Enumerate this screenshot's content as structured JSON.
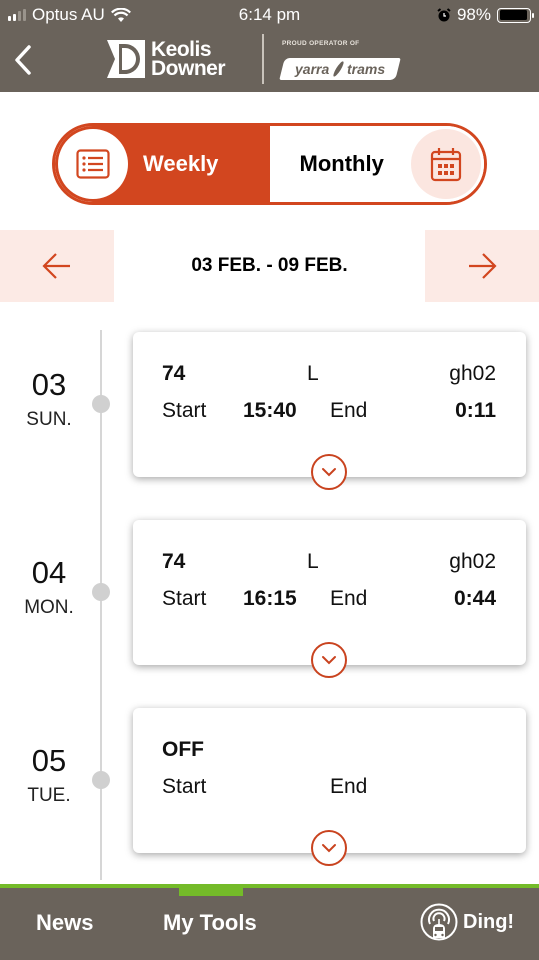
{
  "status_bar": {
    "carrier": "Optus AU",
    "time": "6:14 pm",
    "battery": "98%",
    "battery_level": 0.98,
    "icons": [
      "signal-icon",
      "wifi-icon",
      "alarm-icon",
      "battery-icon"
    ]
  },
  "header": {
    "back_icon": "chevron-left-icon",
    "brand_line1": "Keolis",
    "brand_line2": "Downer",
    "tagline": "PROUD OPERATOR OF",
    "partner_left": "yarra",
    "partner_right": "trams"
  },
  "toggle": {
    "weekly_label": "Weekly",
    "monthly_label": "Monthly",
    "selected": "weekly",
    "weekly_icon": "list-icon",
    "monthly_icon": "calendar-icon"
  },
  "week_nav": {
    "range": "03 FEB. - 09 FEB.",
    "prev_icon": "arrow-left-icon",
    "next_icon": "arrow-right-icon"
  },
  "days": [
    {
      "date": "03",
      "weekday": "SUN.",
      "shift": "74",
      "code": "L",
      "location": "gh02",
      "start_label": "Start",
      "start": "15:40",
      "end_label": "End",
      "end": "0:11"
    },
    {
      "date": "04",
      "weekday": "MON.",
      "shift": "74",
      "code": "L",
      "location": "gh02",
      "start_label": "Start",
      "start": "16:15",
      "end_label": "End",
      "end": "0:44"
    },
    {
      "date": "05",
      "weekday": "TUE.",
      "shift": "OFF",
      "code": "",
      "location": "",
      "start_label": "Start",
      "start": "",
      "end_label": "End",
      "end": ""
    }
  ],
  "bottom_nav": {
    "tabs": [
      {
        "label": "News",
        "active": false
      },
      {
        "label": "My Tools",
        "active": true
      },
      {
        "label": "Ding!",
        "active": false,
        "icon": "broadcast-tram-icon"
      }
    ]
  },
  "colors": {
    "brand_bar": "#6a635b",
    "accent": "#d2461f",
    "accent_light": "#fceae5",
    "active_green": "#74bb29"
  }
}
